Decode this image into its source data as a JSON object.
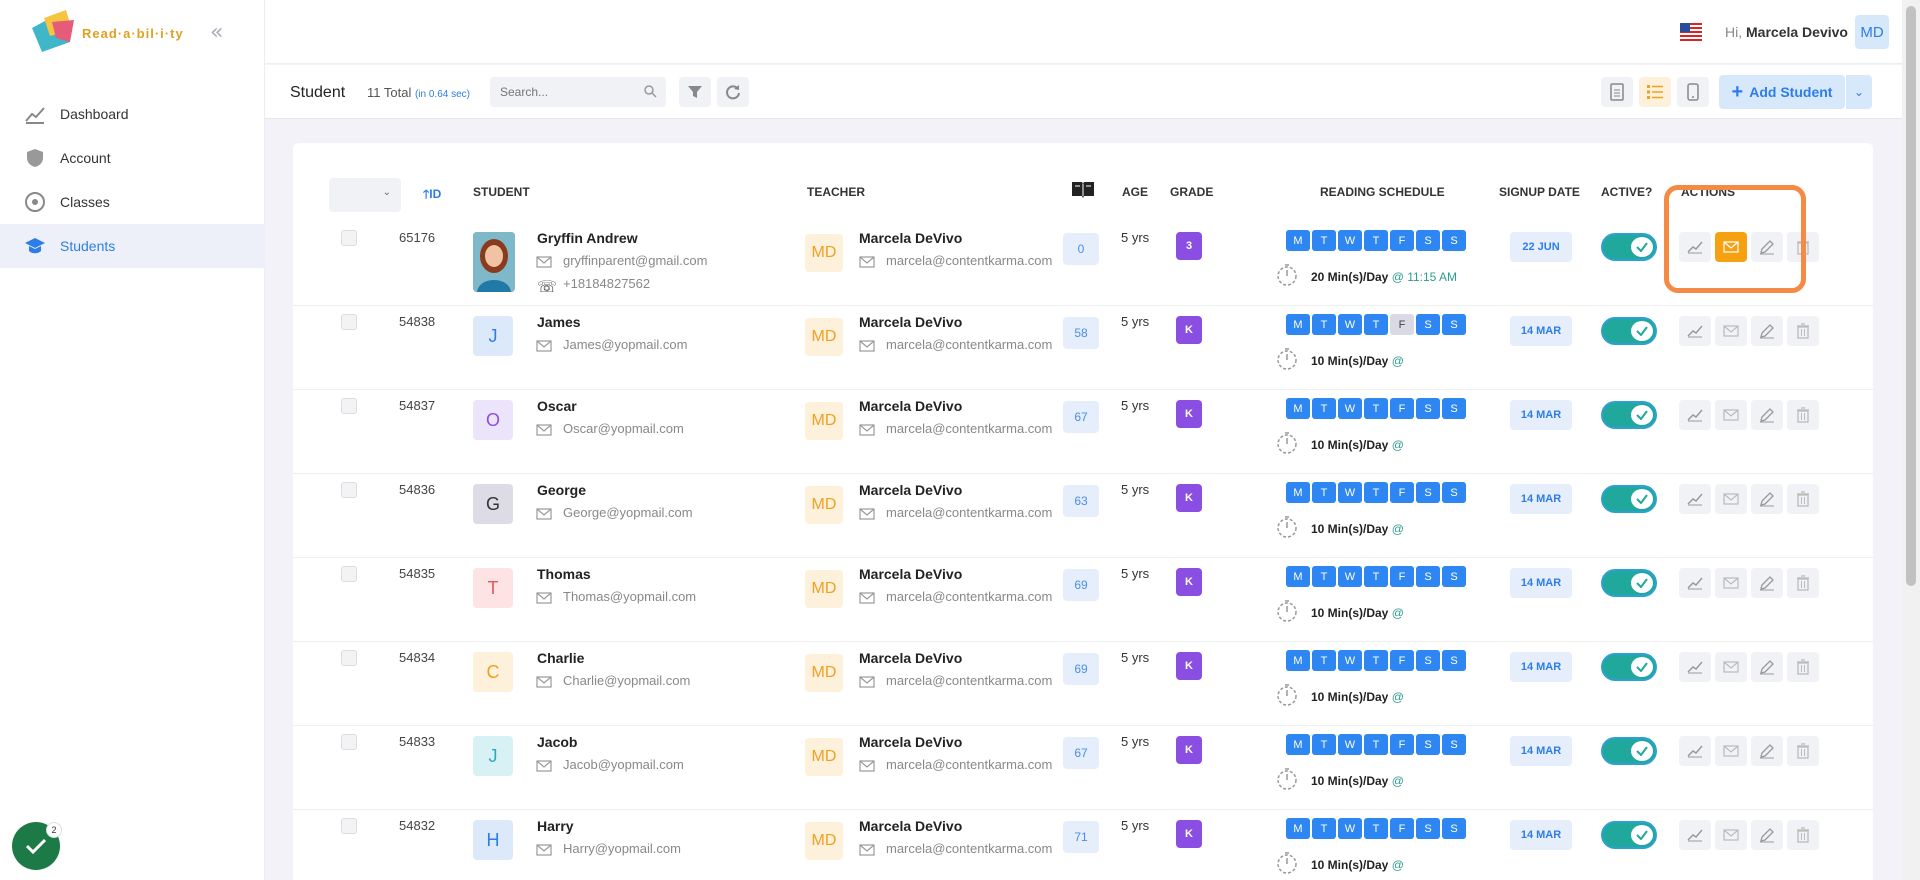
{
  "app": {
    "logo_text": "Read·a·bil·i·ty"
  },
  "sidebar": {
    "items": [
      {
        "label": "Dashboard",
        "icon": "chart-line-icon"
      },
      {
        "label": "Account",
        "icon": "shield-icon"
      },
      {
        "label": "Classes",
        "icon": "classes-icon"
      },
      {
        "label": "Students",
        "icon": "students-icon"
      }
    ],
    "badge_count": "2"
  },
  "header": {
    "greeting": "Hi,",
    "user_name": "Marcela Devivo",
    "user_initials": "MD"
  },
  "toolbar": {
    "title": "Student",
    "total": "11 Total",
    "timing": "(in 0.64 sec)",
    "search_placeholder": "Search...",
    "add_label": "Add Student"
  },
  "table": {
    "headers": {
      "id": "ID",
      "student": "STUDENT",
      "teacher": "TEACHER",
      "age": "AGE",
      "grade": "GRADE",
      "schedule": "READING SCHEDULE",
      "signup": "SIGNUP DATE",
      "active": "ACTIVE?",
      "actions": "ACTIONS"
    },
    "day_letters": [
      "M",
      "T",
      "W",
      "T",
      "F",
      "S",
      "S"
    ],
    "rows": [
      {
        "id": "65176",
        "name": "Gryffin Andrew",
        "initial": "",
        "photo": true,
        "email": "gryffinparent@gmail.com",
        "phone": "+18184827562",
        "teacher": "Marcela DeVivo",
        "teacher_initials": "MD",
        "teacher_email": "marcela@contentkarma.com",
        "books": "0",
        "age": "5 yrs",
        "grade": "3",
        "minutes": "20 Min(s)/Day",
        "time": "@ 11:15 AM",
        "signup": "22 JUN",
        "days_off": []
      },
      {
        "id": "54838",
        "name": "James",
        "initial": "J",
        "email": "James@yopmail.com",
        "teacher": "Marcela DeVivo",
        "teacher_initials": "MD",
        "teacher_email": "marcela@contentkarma.com",
        "books": "58",
        "age": "5 yrs",
        "grade": "K",
        "minutes": "10 Min(s)/Day",
        "time": "@",
        "signup": "14 MAR",
        "days_off": [
          4
        ]
      },
      {
        "id": "54837",
        "name": "Oscar",
        "initial": "O",
        "email": "Oscar@yopmail.com",
        "teacher": "Marcela DeVivo",
        "teacher_initials": "MD",
        "teacher_email": "marcela@contentkarma.com",
        "books": "67",
        "age": "5 yrs",
        "grade": "K",
        "minutes": "10 Min(s)/Day",
        "time": "@",
        "signup": "14 MAR",
        "days_off": []
      },
      {
        "id": "54836",
        "name": "George",
        "initial": "G",
        "email": "George@yopmail.com",
        "teacher": "Marcela DeVivo",
        "teacher_initials": "MD",
        "teacher_email": "marcela@contentkarma.com",
        "books": "63",
        "age": "5 yrs",
        "grade": "K",
        "minutes": "10 Min(s)/Day",
        "time": "@",
        "signup": "14 MAR",
        "days_off": []
      },
      {
        "id": "54835",
        "name": "Thomas",
        "initial": "T",
        "email": "Thomas@yopmail.com",
        "teacher": "Marcela DeVivo",
        "teacher_initials": "MD",
        "teacher_email": "marcela@contentkarma.com",
        "books": "69",
        "age": "5 yrs",
        "grade": "K",
        "minutes": "10 Min(s)/Day",
        "time": "@",
        "signup": "14 MAR",
        "days_off": []
      },
      {
        "id": "54834",
        "name": "Charlie",
        "initial": "C",
        "email": "Charlie@yopmail.com",
        "teacher": "Marcela DeVivo",
        "teacher_initials": "MD",
        "teacher_email": "marcela@contentkarma.com",
        "books": "69",
        "age": "5 yrs",
        "grade": "K",
        "minutes": "10 Min(s)/Day",
        "time": "@",
        "signup": "14 MAR",
        "days_off": []
      },
      {
        "id": "54833",
        "name": "Jacob",
        "initial": "J",
        "email": "Jacob@yopmail.com",
        "teacher": "Marcela DeVivo",
        "teacher_initials": "MD",
        "teacher_email": "marcela@contentkarma.com",
        "books": "67",
        "age": "5 yrs",
        "grade": "K",
        "minutes": "10 Min(s)/Day",
        "time": "@",
        "signup": "14 MAR",
        "days_off": []
      },
      {
        "id": "54832",
        "name": "Harry",
        "initial": "H",
        "email": "Harry@yopmail.com",
        "teacher": "Marcela DeVivo",
        "teacher_initials": "MD",
        "teacher_email": "marcela@contentkarma.com",
        "books": "71",
        "age": "5 yrs",
        "grade": "K",
        "minutes": "10 Min(s)/Day",
        "time": "@",
        "signup": "14 MAR",
        "days_off": []
      }
    ]
  },
  "colors": {
    "accent": "#2d7de8",
    "active": "#1fa89b",
    "highlight": "#f58a45",
    "email_action": "#f5a111",
    "grade": "#8b4ee3"
  },
  "avatar_colors": [
    {
      "bg": "#dbe9fb",
      "fg": "#2d7de8"
    },
    {
      "bg": "#ece4fb",
      "fg": "#8b4ee3"
    },
    {
      "bg": "#dcdbe6",
      "fg": "#333"
    },
    {
      "bg": "#fde3e3",
      "fg": "#e05a5a"
    },
    {
      "bg": "#fdf1dc",
      "fg": "#f0a020"
    },
    {
      "bg": "#d7f1f5",
      "fg": "#2aa9c4"
    },
    {
      "bg": "#dbe9fb",
      "fg": "#2d7de8"
    }
  ]
}
